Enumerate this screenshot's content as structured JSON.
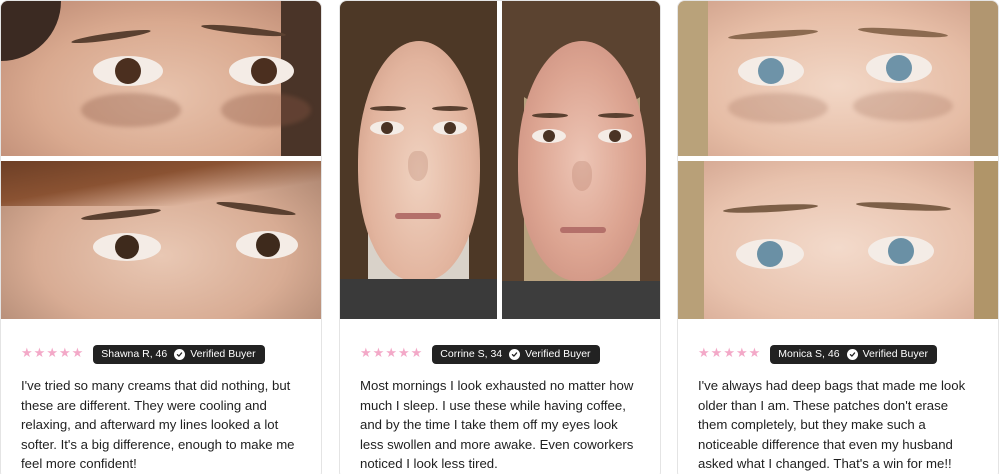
{
  "reviews": [
    {
      "rating": 5,
      "reviewer": "Shawna R, 46",
      "verified_label": "Verified Buyer",
      "text": "I've tried so many creams that did nothing, but these are different. They were cooling and relaxing, and afterward my lines looked a lot softer. It's a big difference, enough to make me feel more confident!"
    },
    {
      "rating": 5,
      "reviewer": "Corrine S, 34",
      "verified_label": "Verified Buyer",
      "text": "Most mornings I look exhausted no matter how much I sleep. I use these while having coffee, and by the time I take them off my eyes look less swollen and more awake. Even coworkers noticed I look less tired."
    },
    {
      "rating": 5,
      "reviewer": "Monica S, 46",
      "verified_label": "Verified Buyer",
      "text": "I've always had deep bags that made me look older than I am. These patches don't erase them completely, but they make such a noticeable difference that even my husband asked what I changed. That's a win for me!!"
    }
  ],
  "icons": {
    "star": "star-icon",
    "verified": "check-circle-icon"
  },
  "colors": {
    "star": "#f3a9c8",
    "badge_bg": "#222222"
  }
}
